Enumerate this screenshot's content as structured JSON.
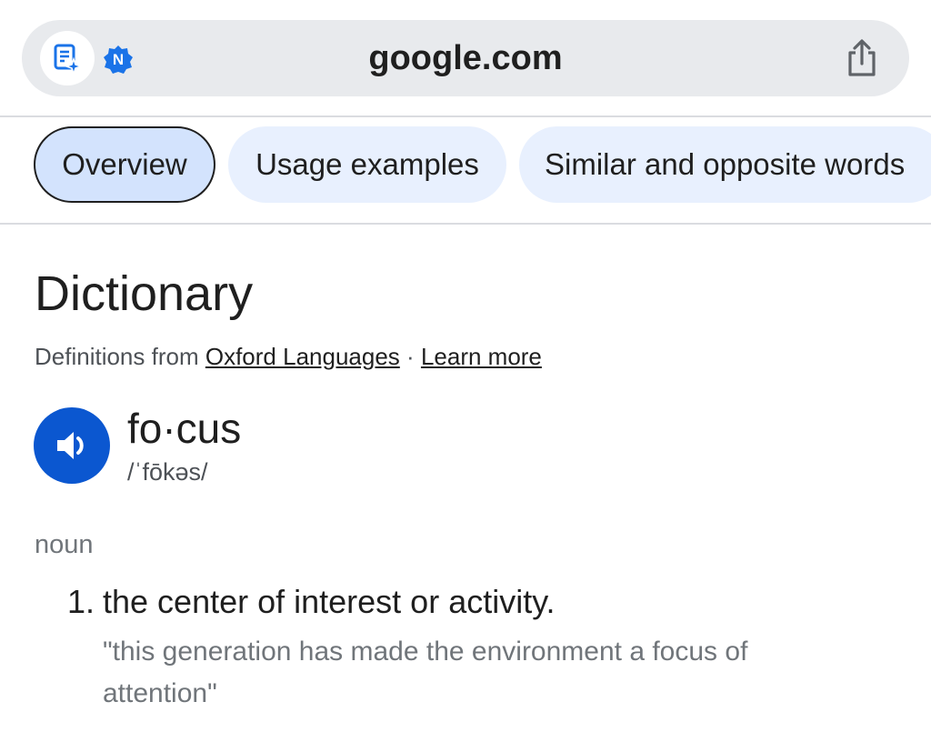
{
  "browser": {
    "url": "google.com",
    "badge": "N",
    "icons": {
      "assistant": "ai-notes-sparkle-icon",
      "badge": "notification-badge-icon",
      "share": "share-icon"
    }
  },
  "tabs": [
    {
      "label": "Overview",
      "active": true
    },
    {
      "label": "Usage examples",
      "active": false
    },
    {
      "label": "Similar and opposite words",
      "active": false
    }
  ],
  "dictionary": {
    "title": "Dictionary",
    "source_prefix": "Definitions from",
    "source_link": "Oxford Languages",
    "separator": "·",
    "learn_more": "Learn more",
    "word": "fo·cus",
    "phonetic": "/ˈfōkəs/",
    "audio_icon": "speaker-icon",
    "part_of_speech": "noun",
    "definitions": [
      {
        "number": "1.",
        "text": "the center of interest or activity.",
        "example": "\"this generation has made the environment a focus of attention\""
      }
    ]
  },
  "colors": {
    "accent": "#0b57d0",
    "chip_bg": "#e8f0fe",
    "chip_active_bg": "#d3e3fd",
    "badge": "#1a73e8"
  }
}
